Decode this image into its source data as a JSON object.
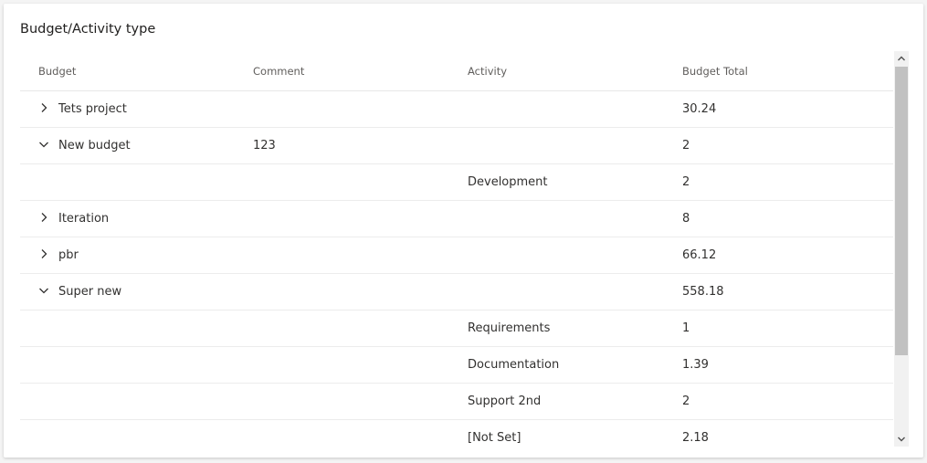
{
  "card": {
    "title": "Budget/Activity type"
  },
  "grid": {
    "columns": {
      "budget": "Budget",
      "comment": "Comment",
      "activity": "Activity",
      "total": "Budget Total"
    },
    "rows": [
      {
        "budget": "Tets project",
        "comment": "",
        "activity": "",
        "total": "30.24",
        "expander": "chevron-right-icon"
      },
      {
        "budget": "New budget",
        "comment": "123",
        "activity": "",
        "total": "2",
        "expander": "chevron-down-icon"
      },
      {
        "budget": "",
        "comment": "",
        "activity": "Development",
        "total": "2",
        "expander": ""
      },
      {
        "budget": "Iteration",
        "comment": "",
        "activity": "",
        "total": "8",
        "expander": "chevron-right-icon"
      },
      {
        "budget": "pbr",
        "comment": "",
        "activity": "",
        "total": "66.12",
        "expander": "chevron-right-icon"
      },
      {
        "budget": "Super new",
        "comment": "",
        "activity": "",
        "total": "558.18",
        "expander": "chevron-down-icon"
      },
      {
        "budget": "",
        "comment": "",
        "activity": "Requirements",
        "total": "1",
        "expander": ""
      },
      {
        "budget": "",
        "comment": "",
        "activity": "Documentation",
        "total": "1.39",
        "expander": ""
      },
      {
        "budget": "",
        "comment": "",
        "activity": "Support 2nd",
        "total": "2",
        "expander": ""
      },
      {
        "budget": "",
        "comment": "",
        "activity": "[Not Set]",
        "total": "2.18",
        "expander": ""
      }
    ]
  },
  "scrollbar": {
    "up_icon": "scroll-up-arrow-icon",
    "down_icon": "scroll-down-arrow-icon"
  },
  "colors": {
    "text": "#323130",
    "header_text": "#605e5c",
    "row_border": "#ececec",
    "scroll_track": "#f1f1f1",
    "scroll_thumb": "#c1c1c1"
  }
}
